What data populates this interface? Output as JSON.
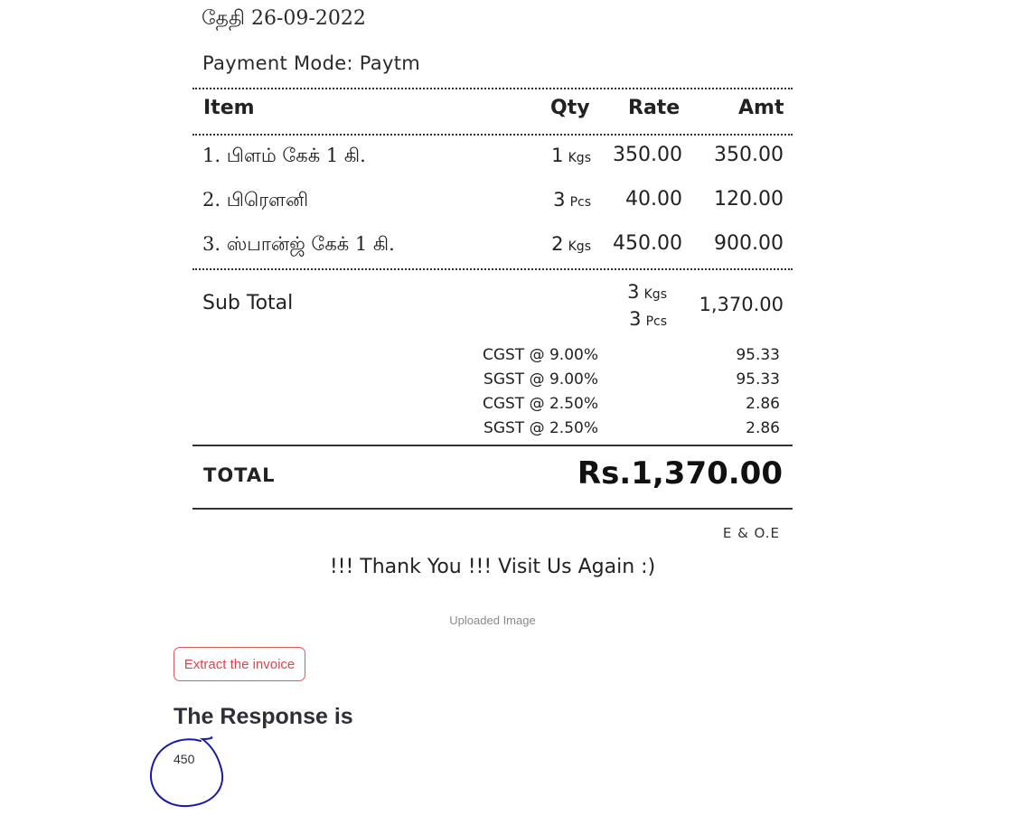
{
  "receipt": {
    "date": "தேதி 26-09-2022",
    "payment_mode": "Payment Mode: Paytm",
    "headers": {
      "item": "Item",
      "qty": "Qty",
      "rate": "Rate",
      "amt": "Amt"
    },
    "items": [
      {
        "name": "1. பிளம் கேக் 1 கி.",
        "qty": "1",
        "unit": "Kgs",
        "rate": "350.00",
        "amt": "350.00"
      },
      {
        "name": "2. பிரௌனி",
        "qty": "3",
        "unit": "Pcs",
        "rate": "40.00",
        "amt": "120.00"
      },
      {
        "name": "3. ஸ்பான்ஜ் கேக் 1 கி.",
        "qty": "2",
        "unit": "Kgs",
        "rate": "450.00",
        "amt": "900.00"
      }
    ],
    "subtotal": {
      "label": "Sub Total",
      "qty1": "3",
      "unit1": "Kgs",
      "qty2": "3",
      "unit2": "Pcs",
      "amount": "1,370.00"
    },
    "taxes": [
      {
        "label": "CGST @ 9.00%",
        "value": "95.33"
      },
      {
        "label": "SGST @ 9.00%",
        "value": "95.33"
      },
      {
        "label": "CGST @ 2.50%",
        "value": "2.86"
      },
      {
        "label": "SGST @ 2.50%",
        "value": "2.86"
      }
    ],
    "total_label": "TOTAL",
    "total_amount": "Rs.1,370.00",
    "eoe": "E & O.E",
    "thanks": "!!! Thank You !!! Visit Us Again :)"
  },
  "caption": "Uploaded Image",
  "extract_button": "Extract the invoice",
  "response_title": "The Response is",
  "response_value": "450",
  "colors": {
    "accent": "#e0454a",
    "annotation": "#1a1aa8"
  }
}
